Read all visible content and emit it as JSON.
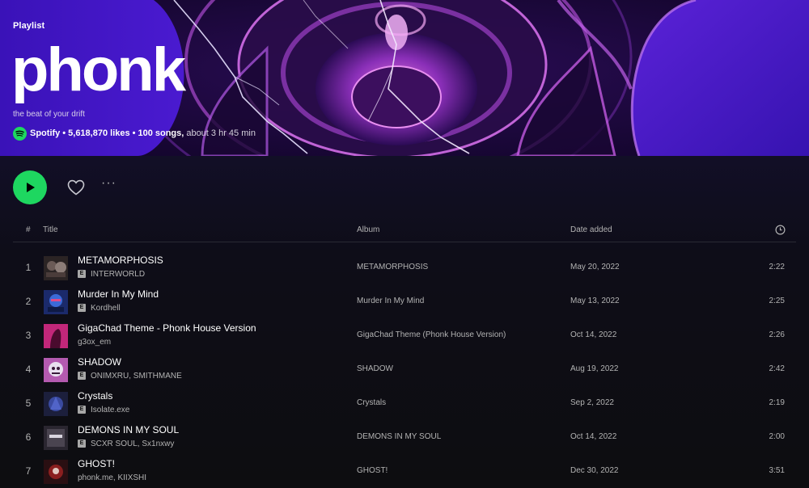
{
  "playlist": {
    "type_label": "Playlist",
    "title": "phonk",
    "description": "the beat of your drift",
    "owner": "Spotify",
    "likes": "5,618,870 likes",
    "song_count": "100 songs,",
    "duration": "about 3 hr 45 min"
  },
  "actions": {
    "play_icon": "play-icon",
    "like_icon": "heart-icon",
    "more_label": "···"
  },
  "table": {
    "headers": {
      "number": "#",
      "title": "Title",
      "album": "Album",
      "date_added": "Date added",
      "duration_icon": "clock-icon"
    },
    "rows": [
      {
        "number": "1",
        "title": "METAMORPHOSIS",
        "explicit": true,
        "artist": "INTERWORLD",
        "album": "METAMORPHOSIS",
        "date_added": "May 20, 2022",
        "duration": "2:22"
      },
      {
        "number": "2",
        "title": "Murder In My Mind",
        "explicit": true,
        "artist": "Kordhell",
        "album": "Murder In My Mind",
        "date_added": "May 13, 2022",
        "duration": "2:25"
      },
      {
        "number": "3",
        "title": "GigaChad Theme - Phonk House Version",
        "explicit": false,
        "artist": "g3ox_em",
        "album": "GigaChad Theme (Phonk House Version)",
        "date_added": "Oct 14, 2022",
        "duration": "2:26"
      },
      {
        "number": "4",
        "title": "SHADOW",
        "explicit": true,
        "artist": "ONIMXRU, SMITHMANE",
        "album": "SHADOW",
        "date_added": "Aug 19, 2022",
        "duration": "2:42"
      },
      {
        "number": "5",
        "title": "Crystals",
        "explicit": true,
        "artist": "Isolate.exe",
        "album": "Crystals",
        "date_added": "Sep 2, 2022",
        "duration": "2:19"
      },
      {
        "number": "6",
        "title": "DEMONS IN MY SOUL",
        "explicit": true,
        "artist": "SCXR SOUL, Sx1nxwy",
        "album": "DEMONS IN MY SOUL",
        "date_added": "Oct 14, 2022",
        "duration": "2:00"
      },
      {
        "number": "7",
        "title": "GHOST!",
        "explicit": false,
        "artist": "phonk.me, KIIXSHI",
        "album": "GHOST!",
        "date_added": "Dec 30, 2022",
        "duration": "3:51"
      }
    ]
  },
  "colors": {
    "accent_green": "#1ed760",
    "hero_purple": "#3b10a8",
    "background": "#121212",
    "text_secondary": "#b3b3b3"
  }
}
